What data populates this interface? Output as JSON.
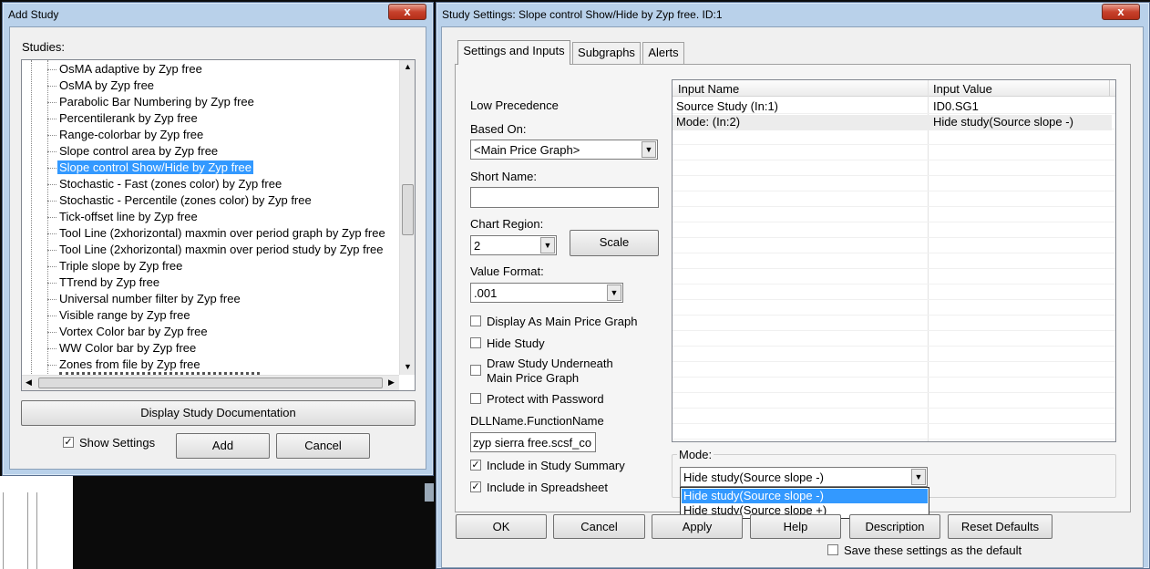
{
  "add_study": {
    "title": "Add Study",
    "close_glyph": "x",
    "studies_label": "Studies:",
    "items": [
      "OsMA adaptive by Zyp free",
      "OsMA by Zyp free",
      "Parabolic Bar Numbering by Zyp free",
      "Percentilerank by Zyp free",
      "Range-colorbar by Zyp free",
      "Slope control area by Zyp free",
      "Slope control Show/Hide by Zyp free",
      "Stochastic - Fast (zones color) by Zyp free",
      "Stochastic - Percentile (zones color) by Zyp free",
      "Tick-offset line by Zyp free",
      "Tool Line (2xhorizontal) maxmin over period graph by Zyp free",
      "Tool Line (2xhorizontal) maxmin over period study by Zyp free",
      "Triple slope by Zyp free",
      "TTrend by Zyp free",
      "Universal number filter by Zyp free",
      "Visible range by Zyp free",
      "Vortex Color bar by Zyp free",
      "WW Color bar by Zyp free",
      "Zones from file by Zyp free"
    ],
    "selected_item": "Slope control Show/Hide by Zyp free",
    "doc_button": "Display Study Documentation",
    "show_settings_label": "Show Settings",
    "show_settings_checked": true,
    "add_button": "Add",
    "cancel_button": "Cancel"
  },
  "study_settings": {
    "title": "Study Settings: Slope control Show/Hide by Zyp free. ID:1",
    "close_glyph": "x",
    "tabs": [
      "Settings and Inputs",
      "Subgraphs",
      "Alerts"
    ],
    "low_precedence": "Low Precedence",
    "based_on_label": "Based On:",
    "based_on_value": "<Main Price Graph>",
    "short_name_label": "Short Name:",
    "short_name_value": "",
    "chart_region_label": "Chart Region:",
    "chart_region_value": "2",
    "scale_button": "Scale",
    "value_format_label": "Value Format:",
    "value_format_value": ".001",
    "checkboxes": [
      {
        "label": "Display As Main Price Graph",
        "checked": false
      },
      {
        "label": "Hide Study",
        "checked": false
      },
      {
        "label": "Draw Study Underneath",
        "label2": "Main Price Graph",
        "checked": false
      },
      {
        "label": "Protect with Password",
        "checked": false
      }
    ],
    "dll_label": "DLLName.FunctionName",
    "dll_value": "zyp sierra free.scsf_co",
    "include_summary_label": "Include in Study Summary",
    "include_summary_checked": true,
    "include_spreadsheet_label": "Include in Spreadsheet",
    "include_spreadsheet_checked": true,
    "grid": {
      "headers": [
        "Input Name",
        "Input Value"
      ],
      "rows": [
        {
          "name": "Source Study   (In:1)",
          "value": "ID0.SG1"
        },
        {
          "name": "Mode:   (In:2)",
          "value": "Hide study(Source slope -)"
        }
      ]
    },
    "mode_group_label": "Mode:",
    "mode_value": "Hide study(Source slope -)",
    "mode_options": [
      "Hide study(Source slope -)",
      "Hide study(Source slope +)"
    ],
    "mode_highlighted": "Hide study(Source slope -)",
    "buttons": {
      "ok": "OK",
      "cancel": "Cancel",
      "apply": "Apply",
      "help": "Help",
      "description": "Description",
      "reset": "Reset Defaults"
    },
    "save_default_label": "Save these settings as the default",
    "save_default_checked": false
  },
  "colors": {
    "frame": "#b9d1ea",
    "selection": "#3399ff",
    "close": "#c7412c"
  }
}
